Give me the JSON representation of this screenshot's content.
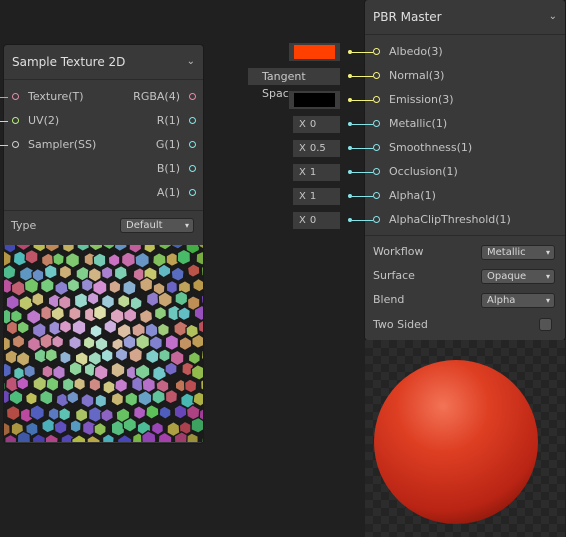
{
  "sample_node": {
    "title": "Sample Texture 2D",
    "inputs": [
      {
        "label": "Texture(T)",
        "color": "#e58aa7"
      },
      {
        "label": "UV(2)",
        "color": "#b6f07a"
      },
      {
        "label": "Sampler(SS)",
        "color": "#cfcfcf"
      }
    ],
    "outputs": [
      {
        "label": "RGBA(4)",
        "color": "#e58aa7"
      },
      {
        "label": "R(1)",
        "color": "#84e4e7"
      },
      {
        "label": "G(1)",
        "color": "#84e4e7"
      },
      {
        "label": "B(1)",
        "color": "#84e4e7"
      },
      {
        "label": "A(1)",
        "color": "#84e4e7"
      }
    ],
    "type_label": "Type",
    "type_value": "Default",
    "preview_icon": "voronoi-texture-preview"
  },
  "master_node": {
    "title": "PBR Master",
    "inputs": [
      {
        "label": "Albedo(3)",
        "color": "#f3f37a",
        "default_kind": "color",
        "default_color": "#ff4000"
      },
      {
        "label": "Normal(3)",
        "color": "#f3f37a",
        "default_kind": "text",
        "default_text": "Tangent Space"
      },
      {
        "label": "Emission(3)",
        "color": "#f3f37a",
        "default_kind": "color",
        "default_color": "#000000"
      },
      {
        "label": "Metallic(1)",
        "color": "#84e4e7",
        "default_kind": "number",
        "prefix": "X",
        "value": "0"
      },
      {
        "label": "Smoothness(1)",
        "color": "#84e4e7",
        "default_kind": "number",
        "prefix": "X",
        "value": "0.5"
      },
      {
        "label": "Occlusion(1)",
        "color": "#84e4e7",
        "default_kind": "number",
        "prefix": "X",
        "value": "1"
      },
      {
        "label": "Alpha(1)",
        "color": "#84e4e7",
        "default_kind": "number",
        "prefix": "X",
        "value": "1"
      },
      {
        "label": "AlphaClipThreshold(1)",
        "color": "#84e4e7",
        "default_kind": "number",
        "prefix": "X",
        "value": "0"
      }
    ],
    "settings": [
      {
        "label": "Workflow",
        "value": "Metallic"
      },
      {
        "label": "Surface",
        "value": "Opaque"
      },
      {
        "label": "Blend",
        "value": "Alpha"
      }
    ],
    "two_sided_label": "Two Sided",
    "two_sided_checked": false,
    "preview_icon": "sphere-preview"
  }
}
